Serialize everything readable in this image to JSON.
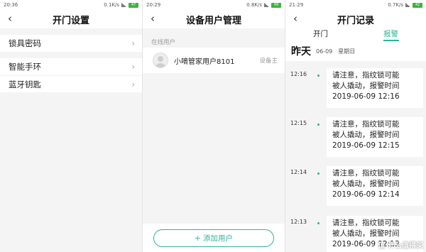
{
  "screens": {
    "lock_settings": {
      "status_time": "20:36",
      "status_speed": "0.1K/s",
      "battery": "47",
      "title": "开门设置",
      "group1": [
        {
          "label": "锁具密码"
        }
      ],
      "group2": [
        {
          "label": "智能手环"
        },
        {
          "label": "蓝牙钥匙"
        }
      ]
    },
    "user_management": {
      "status_time": "20:29",
      "status_speed": "0.8K/s",
      "battery": "49",
      "title": "设备用户管理",
      "section_label": "在线用户",
      "user": {
        "name": "小嘀管家用户8101",
        "role": "设备主"
      },
      "add_button": "+ 添加用户"
    },
    "door_log": {
      "status_time": "21:29",
      "status_speed": "0.7K/s",
      "battery": "42",
      "title": "开门记录",
      "tabs": [
        {
          "label": "开门"
        },
        {
          "label": "报警"
        }
      ],
      "active_tab": "报警",
      "day": {
        "label": "昨天",
        "date": "06-09",
        "weekday": "星期日"
      },
      "entries": [
        {
          "time": "12:16",
          "lines": [
            "请注意，指纹锁可能",
            "被人撬动，报警时间",
            "2019-06-09 12:16"
          ]
        },
        {
          "time": "12:15",
          "lines": [
            "请注意，指纹锁可能",
            "被人撬动，报警时间",
            "2019-06-09 12:15"
          ]
        },
        {
          "time": "12:14",
          "lines": [
            "请注意，指纹锁可能",
            "被人撬动，报警时间",
            "2019-06-09 12:14"
          ]
        },
        {
          "time": "12:13",
          "lines": [
            "请注意，指纹锁可能",
            "被人撬动，报警时间",
            "2019-06-09 12:13"
          ]
        }
      ]
    }
  },
  "icons": {
    "back": "back-arrow-icon",
    "chevron": "chevron-right-icon",
    "avatar": "user-avatar-icon"
  },
  "colors": {
    "accent": "#2bb598",
    "battery": "#3cb43c"
  },
  "watermark": "值 什么值得买"
}
